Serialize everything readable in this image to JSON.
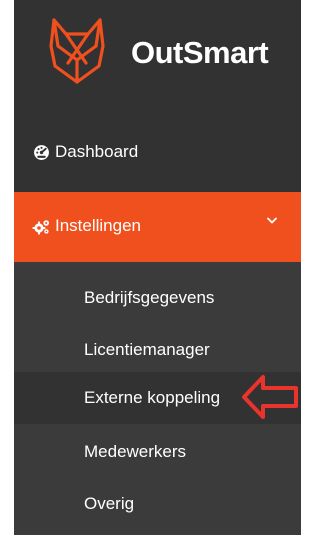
{
  "brand": {
    "logo_text": "OutSmart",
    "accent_color": "#f0501e"
  },
  "nav": {
    "dashboard": {
      "label": "Dashboard",
      "icon": "tachometer-icon"
    },
    "instellingen": {
      "label": "Instellingen",
      "icon": "cogs-icon",
      "expanded": true
    }
  },
  "submenu": {
    "items": [
      {
        "label": "Bedrijfsgegevens"
      },
      {
        "label": "Licentiemanager"
      },
      {
        "label": "Externe koppeling",
        "highlighted": true
      },
      {
        "label": "Medewerkers"
      },
      {
        "label": "Overig"
      }
    ]
  },
  "annotation": {
    "icon": "arrow-left-icon",
    "color": "#e8342c"
  }
}
